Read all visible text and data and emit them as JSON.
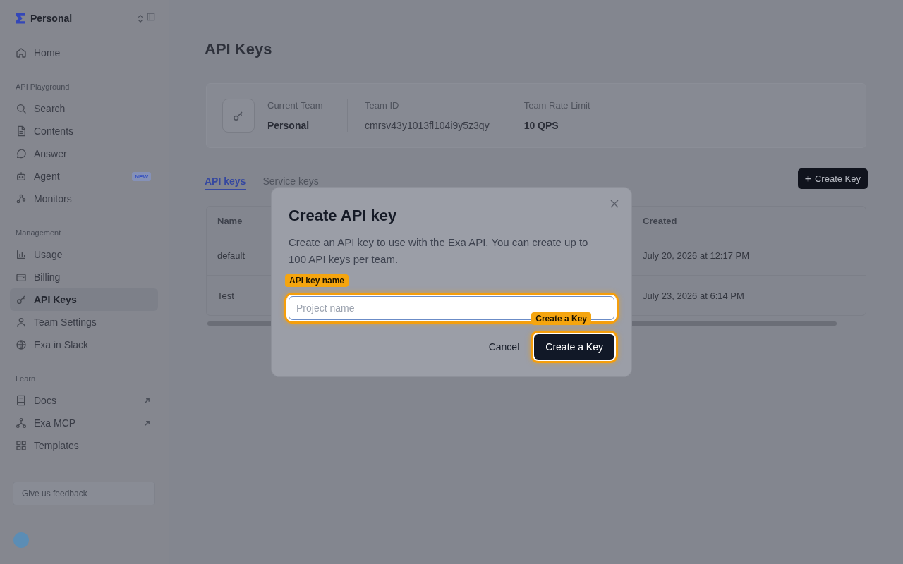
{
  "sidebar": {
    "workspace": "Personal",
    "sections": [
      {
        "items": [
          {
            "label": "Home",
            "selected": false,
            "external": false
          }
        ]
      },
      {
        "title": "API Playground",
        "items": [
          {
            "label": "Search",
            "selected": false,
            "external": false
          },
          {
            "label": "Contents",
            "selected": false,
            "external": false
          },
          {
            "label": "Answer",
            "selected": false,
            "external": false
          },
          {
            "label": "Agent",
            "selected": false,
            "external": false,
            "badge": "NEW"
          },
          {
            "label": "Monitors",
            "selected": false,
            "external": false
          }
        ]
      },
      {
        "title": "Management",
        "items": [
          {
            "label": "Usage",
            "selected": false,
            "external": false
          },
          {
            "label": "Billing",
            "selected": false,
            "external": false
          },
          {
            "label": "API Keys",
            "selected": true,
            "external": false
          },
          {
            "label": "Team Settings",
            "selected": false,
            "external": false
          },
          {
            "label": "Exa in Slack",
            "selected": false,
            "external": false
          }
        ]
      },
      {
        "title": "Learn",
        "items": [
          {
            "label": "Docs",
            "selected": false,
            "external": true
          },
          {
            "label": "Exa MCP",
            "selected": false,
            "external": true
          },
          {
            "label": "Templates",
            "selected": false,
            "external": false
          }
        ]
      }
    ],
    "feedback_button": "Give us feedback"
  },
  "page": {
    "title": "API Keys",
    "team_card": {
      "fields": [
        {
          "label": "Current Team",
          "value": "Personal",
          "kind": "strong"
        },
        {
          "label": "Team ID",
          "value": "cmrsv43y1013fl104i9y5z3qy",
          "kind": "plain"
        },
        {
          "label": "Team Rate Limit",
          "value": "10 QPS",
          "kind": "strong"
        }
      ]
    },
    "tabs": [
      {
        "label": "API keys",
        "selected": true
      },
      {
        "label": "Service keys",
        "selected": false
      }
    ],
    "create_button": "Create Key",
    "table": {
      "columns": [
        "Name",
        "Created"
      ],
      "rows": [
        [
          "default",
          "July 20, 2026 at 12:17 PM"
        ],
        [
          "Test",
          "July 23, 2026 at 6:14 PM"
        ]
      ]
    }
  },
  "dialog": {
    "title": "Create API key",
    "description": "Create an API key to use with the Exa API. You can create up to 100 API keys per team.",
    "field": {
      "placeholder": "Project name",
      "highlight": "API key name"
    },
    "buttons": [
      {
        "label": "Cancel",
        "kind": "secondary"
      },
      {
        "label": "Create a Key",
        "kind": "primary",
        "highlight": "Create a Key"
      }
    ]
  }
}
